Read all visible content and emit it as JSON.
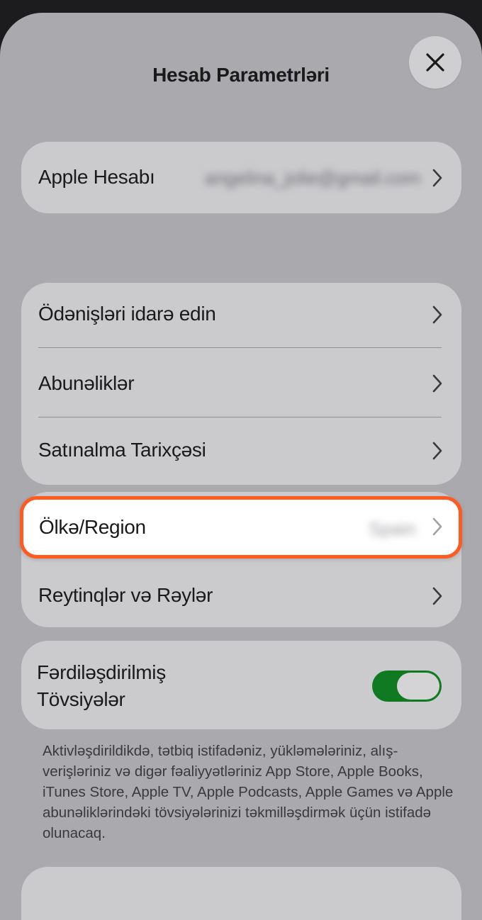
{
  "header": {
    "title": "Hesab Parametrləri",
    "close_icon": "close-icon"
  },
  "account": {
    "label": "Apple Hesabı",
    "email": "angelina_jolie@gmail.com"
  },
  "menu": {
    "payments": "Ödənişləri idarə edin",
    "subscriptions": "Abunəliklər",
    "purchase_history": "Satınalma Tarixçəsi",
    "country_region": "Ölkə/Region",
    "country_value": "Spain",
    "ratings": "Reytinqlər və Rəylər"
  },
  "personalized": {
    "label_line1": "Fərdiləşdirilmiş",
    "label_line2": "Tövsiyələr",
    "enabled": true,
    "toggle_color": "#0f7a22"
  },
  "footnote": "Aktivləşdirildikdə, tətbiq istifadəniz, yükləmələriniz, alış-verişləriniz və digər fəaliyyətləriniz App Store, Apple Books, iTunes Store, Apple TV, Apple Podcasts, Apple Games və Apple abunəliklərindəki tövsiyələrinizi təkmilləşdirmək üçün istifadə olunacaq.",
  "colors": {
    "highlight_border": "#ff5a1f",
    "sheet_bg": "#a9a9ae",
    "card_bg": "#cbcbce"
  }
}
